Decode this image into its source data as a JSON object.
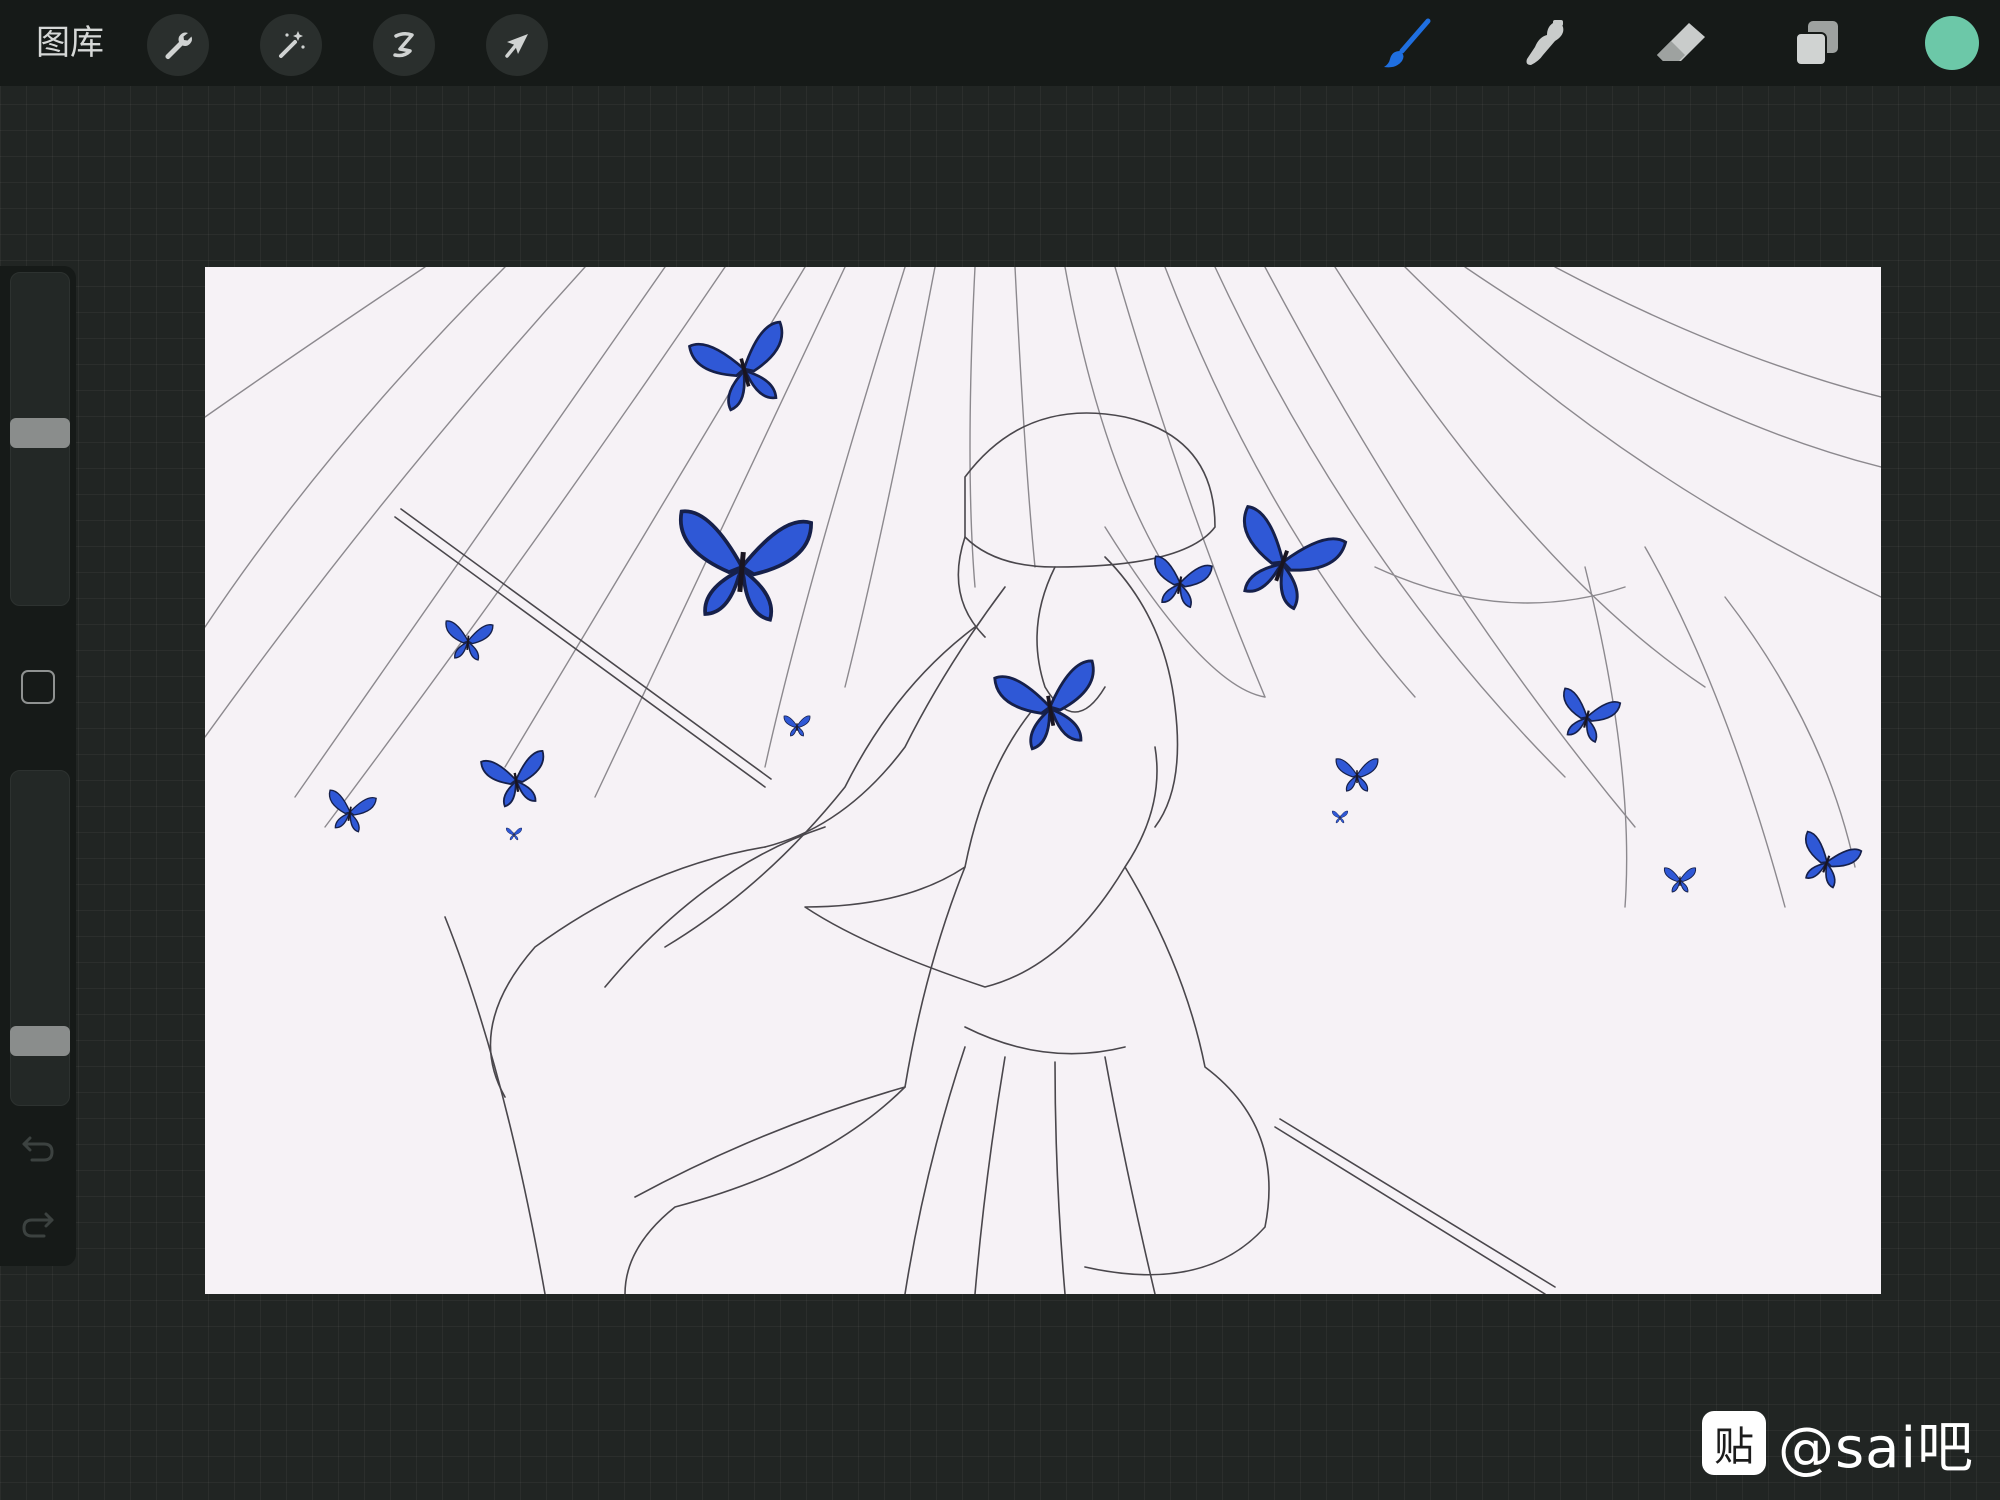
{
  "toolbar": {
    "gallery_label": "图库",
    "left_tools": [
      "wrench-icon",
      "magic-wand-icon",
      "selection-icon",
      "transform-arrow-icon"
    ],
    "right_tools": [
      "brush-icon",
      "smudge-icon",
      "eraser-icon",
      "layers-icon"
    ],
    "active_tool": "brush-icon",
    "active_tool_color": "#1f6fe0",
    "current_color": "#6cc8a8"
  },
  "sidebar": {
    "brush_size_level": 0.52,
    "opacity_level": 0.16,
    "modify_button_icon": "square-icon",
    "undo_icon": "undo-icon",
    "redo_icon": "redo-icon"
  },
  "canvas": {
    "background_color": "#f6f2f6",
    "artwork_description_icon": "line-art-girl-with-blue-butterflies",
    "butterfly_color": "#2f58d6"
  },
  "watermark": {
    "logo_text": "贴",
    "text": "@sai吧"
  }
}
